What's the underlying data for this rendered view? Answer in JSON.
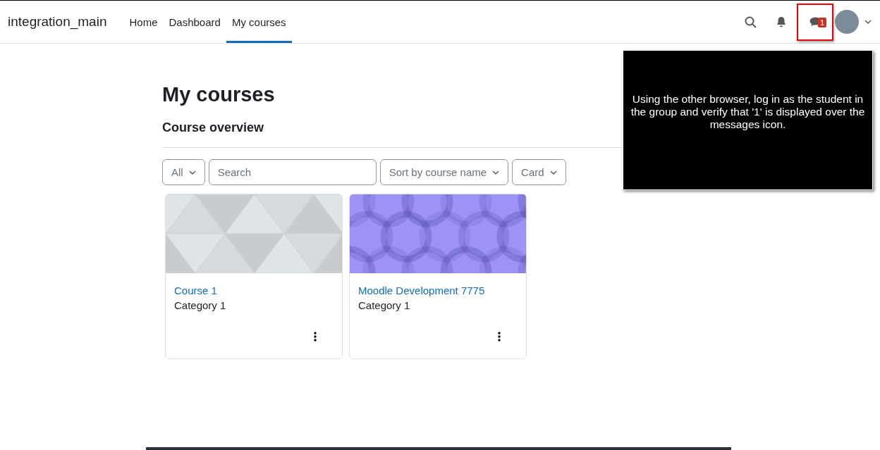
{
  "navbar": {
    "site_name": "integration_main",
    "nav_items": [
      {
        "label": "Home",
        "selected": false
      },
      {
        "label": "Dashboard",
        "selected": false
      },
      {
        "label": "My courses",
        "selected": true
      }
    ],
    "message_badge": "1"
  },
  "page": {
    "title": "My courses",
    "section_title": "Course overview"
  },
  "filters": {
    "grouping": "All",
    "search": {
      "placeholder": "Search"
    },
    "sort": "Sort by course name",
    "view": "Card"
  },
  "courses": [
    {
      "name": "Course 1",
      "category": "Category 1",
      "kind": "triangles"
    },
    {
      "name": "Moodle Development 7775",
      "category": "Category 1",
      "kind": "circles"
    }
  ],
  "overlay": {
    "instruction": "Using the other browser, log in as the student in the group and verify that '1' is displayed over the messages icon."
  }
}
